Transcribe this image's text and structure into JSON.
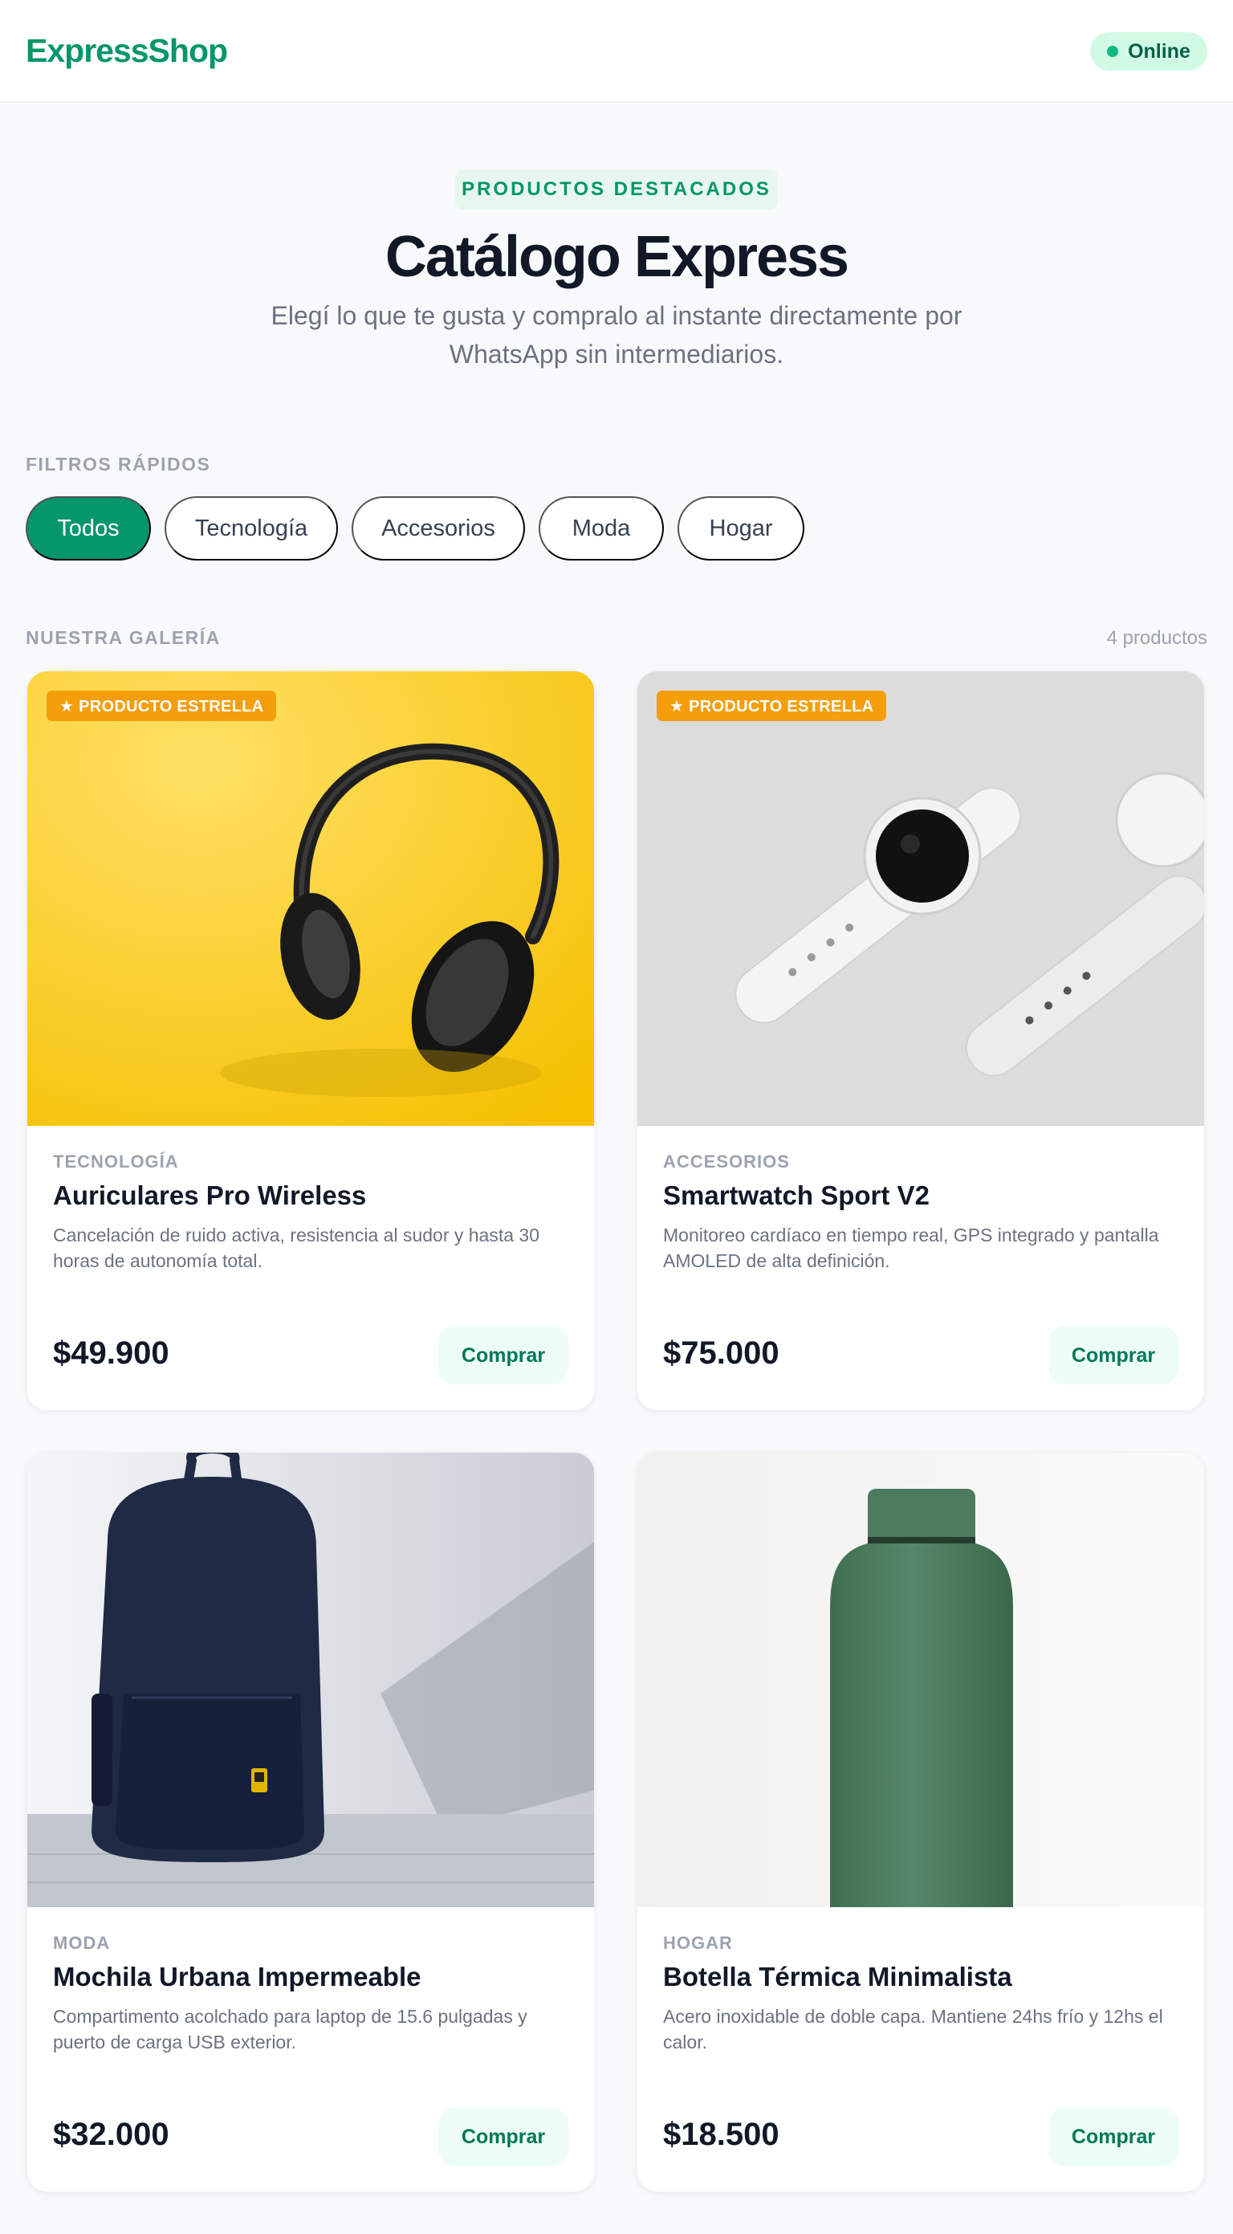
{
  "header": {
    "logo": "ExpressShop",
    "status": "Online"
  },
  "hero": {
    "badge": "PRODUCTOS DESTACADOS",
    "title": "Catálogo Express",
    "subtitle": "Elegí lo que te gusta y compralo al instante directamente por WhatsApp sin intermediarios."
  },
  "filters": {
    "label": "FILTROS RÁPIDOS",
    "chips": [
      "Todos",
      "Tecnología",
      "Accesorios",
      "Moda",
      "Hogar"
    ],
    "active": "Todos"
  },
  "gallery": {
    "label": "NUESTRA GALERÍA",
    "count": "4 productos",
    "products": [
      {
        "badge": "★ PRODUCTO ESTRELLA",
        "category": "TECNOLOGÍA",
        "name": "Auriculares Pro Wireless",
        "description": "Cancelación de ruido activa, resistencia al sudor y hasta 30 horas de autonomía total.",
        "price": "$49.900",
        "button": "Comprar",
        "image": "headphones"
      },
      {
        "badge": "★ PRODUCTO ESTRELLA",
        "category": "ACCESORIOS",
        "name": "Smartwatch Sport V2",
        "description": "Monitoreo cardíaco en tiempo real, GPS integrado y pantalla AMOLED de alta definición.",
        "price": "$75.000",
        "button": "Comprar",
        "image": "smartwatch"
      },
      {
        "category": "MODA",
        "name": "Mochila Urbana Impermeable",
        "description": "Compartimento acolchado para laptop de 15.6 pulgadas y puerto de carga USB exterior.",
        "price": "$32.000",
        "button": "Comprar",
        "image": "backpack"
      },
      {
        "category": "HOGAR",
        "name": "Botella Térmica Minimalista",
        "description": "Acero inoxidable de doble capa. Mantiene 24hs frío y 12hs el calor.",
        "price": "$18.500",
        "button": "Comprar",
        "image": "bottle"
      }
    ]
  },
  "colors": {
    "brand": "#059669",
    "badge": "#f59e0b",
    "status_bg": "#d1fae5"
  }
}
